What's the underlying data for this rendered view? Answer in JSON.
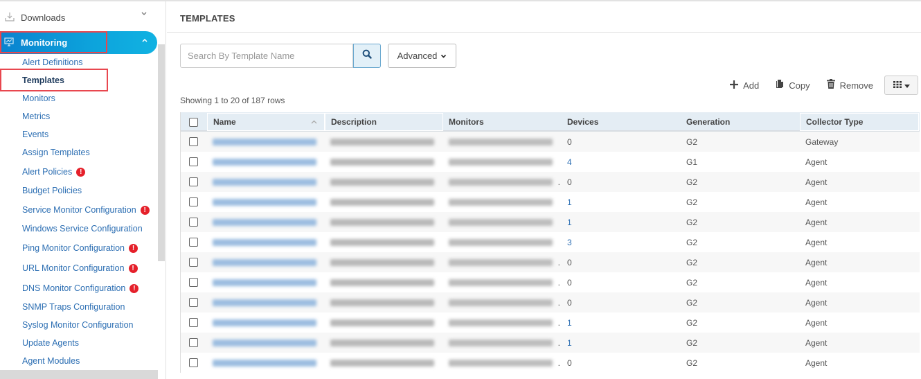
{
  "sidebar": {
    "top_item": {
      "label": "Downloads",
      "icon": "download-icon",
      "chevron": "chevron-down-icon"
    },
    "active_section": {
      "label": "Monitoring",
      "icon": "monitor-chart-icon",
      "chevron": "chevron-up-icon"
    },
    "items": [
      {
        "label": "Alert Definitions",
        "selected": false,
        "alert": false
      },
      {
        "label": "Templates",
        "selected": true,
        "alert": false
      },
      {
        "label": "Monitors",
        "selected": false,
        "alert": false
      },
      {
        "label": "Metrics",
        "selected": false,
        "alert": false
      },
      {
        "label": "Events",
        "selected": false,
        "alert": false
      },
      {
        "label": "Assign Templates",
        "selected": false,
        "alert": false
      },
      {
        "label": "Alert Policies",
        "selected": false,
        "alert": true
      },
      {
        "label": "Budget Policies",
        "selected": false,
        "alert": false
      },
      {
        "label": "Service Monitor Configuration",
        "selected": false,
        "alert": true
      },
      {
        "label": "Windows Service Configuration",
        "selected": false,
        "alert": false
      },
      {
        "label": "Ping Monitor Configuration",
        "selected": false,
        "alert": true
      },
      {
        "label": "URL Monitor Configuration",
        "selected": false,
        "alert": true
      },
      {
        "label": "DNS Monitor Configuration",
        "selected": false,
        "alert": true
      },
      {
        "label": "SNMP Traps Configuration",
        "selected": false,
        "alert": false
      },
      {
        "label": "Syslog Monitor Configuration",
        "selected": false,
        "alert": false
      },
      {
        "label": "Update Agents",
        "selected": false,
        "alert": false
      },
      {
        "label": "Agent Modules",
        "selected": false,
        "alert": false
      }
    ],
    "alert_badge_glyph": "!"
  },
  "main": {
    "title": "TEMPLATES",
    "search": {
      "placeholder": "Search By Template Name",
      "value": ""
    },
    "advanced_label": "Advanced",
    "toolbar": {
      "add_label": "Add",
      "copy_label": "Copy",
      "remove_label": "Remove"
    },
    "showing_text": "Showing 1 to 20 of 187 rows",
    "table": {
      "columns": [
        "Name",
        "Description",
        "Monitors",
        "Devices",
        "Generation",
        "Collector Type"
      ],
      "rows": [
        {
          "name": "[redacted]",
          "description": "[redacted]",
          "monitors": "[redacted]",
          "monitors_truncated": false,
          "devices": "0",
          "generation": "G2",
          "collector": "Gateway"
        },
        {
          "name": "[redacted]",
          "description": "[redacted]",
          "monitors": "[redacted]",
          "monitors_truncated": false,
          "devices": "4",
          "generation": "G1",
          "collector": "Agent"
        },
        {
          "name": "[redacted]",
          "description": "[redacted]",
          "monitors": "[redacted]",
          "monitors_truncated": true,
          "devices": "0",
          "generation": "G2",
          "collector": "Agent"
        },
        {
          "name": "[redacted]",
          "description": "[redacted]",
          "monitors": "[redacted]",
          "monitors_truncated": false,
          "devices": "1",
          "generation": "G2",
          "collector": "Agent"
        },
        {
          "name": "[redacted]",
          "description": "[redacted]",
          "monitors": "[redacted]",
          "monitors_truncated": false,
          "devices": "1",
          "generation": "G2",
          "collector": "Agent"
        },
        {
          "name": "[redacted]",
          "description": "[redacted]",
          "monitors": "[redacted]",
          "monitors_truncated": false,
          "devices": "3",
          "generation": "G2",
          "collector": "Agent"
        },
        {
          "name": "[redacted]",
          "description": "[redacted]",
          "monitors": "[redacted]",
          "monitors_truncated": true,
          "devices": "0",
          "generation": "G2",
          "collector": "Agent"
        },
        {
          "name": "[redacted]",
          "description": "[redacted]",
          "monitors": "[redacted]",
          "monitors_truncated": true,
          "devices": "0",
          "generation": "G2",
          "collector": "Agent"
        },
        {
          "name": "[redacted]",
          "description": "[redacted]",
          "monitors": "[redacted]",
          "monitors_truncated": true,
          "devices": "0",
          "generation": "G2",
          "collector": "Agent"
        },
        {
          "name": "[redacted]",
          "description": "[redacted]",
          "monitors": "[redacted]",
          "monitors_truncated": true,
          "devices": "1",
          "generation": "G2",
          "collector": "Agent"
        },
        {
          "name": "[redacted]",
          "description": "[redacted]",
          "monitors": "[redacted]",
          "monitors_truncated": true,
          "devices": "1",
          "generation": "G2",
          "collector": "Agent"
        },
        {
          "name": "[redacted]",
          "description": "[redacted]",
          "monitors": "[redacted]",
          "monitors_truncated": true,
          "devices": "0",
          "generation": "G2",
          "collector": "Agent"
        }
      ]
    }
  },
  "colors": {
    "accent": "#0a82cf",
    "link": "#2d6fb3",
    "highlight_box": "#e8474f",
    "alert_badge": "#e5202a",
    "table_header_bg": "#e4edf4"
  }
}
